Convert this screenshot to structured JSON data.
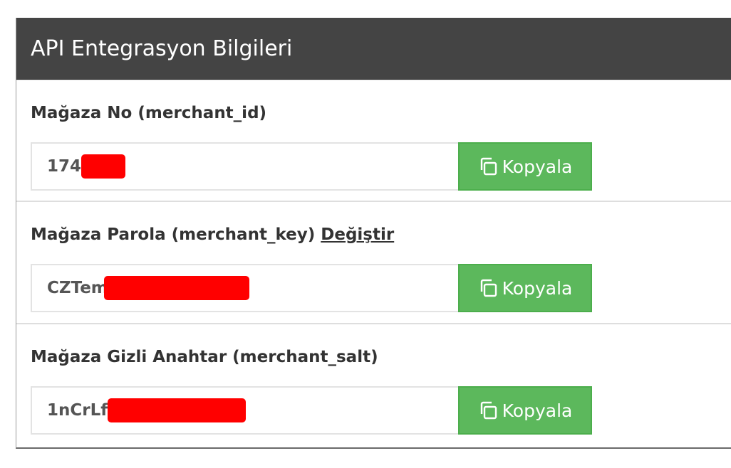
{
  "panel": {
    "title": "API Entegrasyon Bilgileri"
  },
  "fields": [
    {
      "label": "Mağaza No (merchant_id)",
      "value": "174",
      "copy_label": "Kopyala"
    },
    {
      "label": "Mağaza Parola (merchant_key)",
      "link_label": "Değiştir",
      "value": "CZTem",
      "copy_label": "Kopyala"
    },
    {
      "label": "Mağaza Gizli Anahtar (merchant_salt)",
      "value": "1nCrLf",
      "copy_label": "Kopyala"
    }
  ],
  "colors": {
    "header_bg": "#444444",
    "copy_button": "#5cb85c",
    "redaction": "#ff0000"
  },
  "icons": {
    "copy": "copy-icon"
  }
}
